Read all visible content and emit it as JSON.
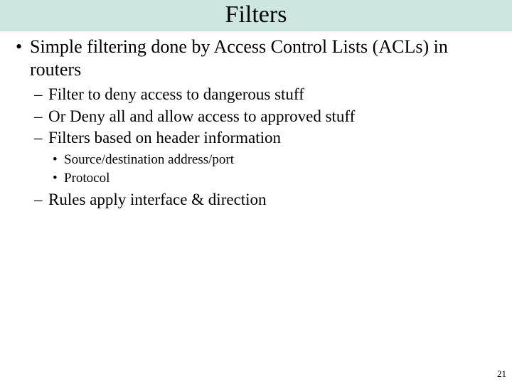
{
  "title": "Filters",
  "bullets": {
    "l1_0": "Simple filtering done by Access Control Lists (ACLs) in routers",
    "l2_0": "Filter to deny access to dangerous stuff",
    "l2_1": "Or Deny all and allow access to approved stuff",
    "l2_2": "Filters based on header information",
    "l3_0": "Source/destination address/port",
    "l3_1": "Protocol",
    "l2_3": "Rules apply interface & direction"
  },
  "page_number": "21"
}
